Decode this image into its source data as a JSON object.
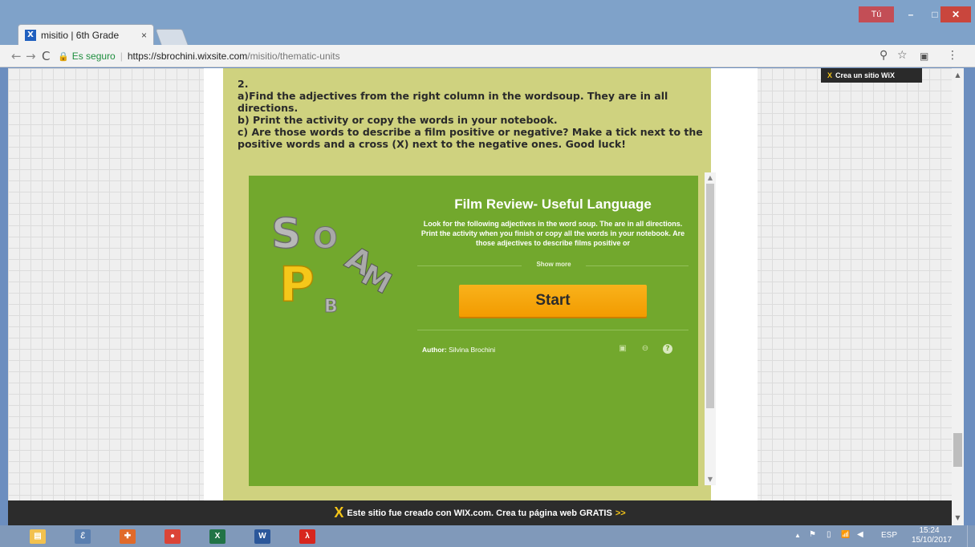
{
  "browser": {
    "tab_title": "misitio | 6th Grade",
    "tab_close": "×",
    "user_label": "Tú",
    "min": "–",
    "max": "□",
    "close": "✕",
    "back": "←",
    "forward": "→",
    "reload": "C",
    "secure_label": "Es seguro",
    "separator": "|",
    "url_host": "https://sbrochini.wixsite.com",
    "url_path": "/misitio/thematic-units",
    "zoom_icon": "⚲",
    "star_icon": "☆",
    "ext_icon": "▣",
    "menu_icon": "⋮"
  },
  "page": {
    "instructions": [
      "2.",
      "a)Find the adjectives from the right column in the wordsoup. They are in all directions.",
      "b) Print the activity or copy the words in your notebook.",
      "c) Are those words to describe a film positive or negative? Make a tick next to the positive words and a cross (X) next to the negative ones. Good luck!"
    ],
    "wix_tag": "Crea un sitio WiX",
    "wix_tag_x": "X"
  },
  "activity": {
    "title": "Film Review- Useful Language",
    "description": "Look for the following adjectives in the word soup. The are in all directions. Print the activity when you finish or copy all the words in your notebook. Are those adjectives to describe films positive or",
    "show_more": "Show more",
    "start": "Start",
    "author_label": "Author:",
    "author_name": "Silvina Brochini",
    "logo_letters": [
      "S",
      "O",
      "P",
      "B",
      "A",
      "M"
    ],
    "icons": [
      "image-icon",
      "embed-icon",
      "help-icon"
    ]
  },
  "banner": {
    "x": "X",
    "text": "Este sitio fue creado con WIX.com. Crea tu página web GRATIS",
    "cta": ">>"
  },
  "taskbar": {
    "apps": [
      {
        "name": "file-explorer",
        "glyph": "▤",
        "color": "#f2c14e"
      },
      {
        "name": "app-2",
        "glyph": "ℰ",
        "color": "#5a7fb0"
      },
      {
        "name": "app-3",
        "glyph": "✚",
        "color": "#e06a2a"
      },
      {
        "name": "chrome",
        "glyph": "●",
        "color": "#db4437"
      },
      {
        "name": "excel",
        "glyph": "X",
        "color": "#217346"
      },
      {
        "name": "word",
        "glyph": "W",
        "color": "#2b579a"
      },
      {
        "name": "acrobat",
        "glyph": "λ",
        "color": "#d7261e"
      }
    ],
    "tray_up": "▲",
    "tray_flag": "⚑",
    "tray_battery": "▯",
    "tray_signal": "📶",
    "tray_volume": "◀",
    "language": "ESP",
    "time": "15:24",
    "date": "15/10/2017"
  },
  "scroll": {
    "up": "▲",
    "down": "▼"
  }
}
